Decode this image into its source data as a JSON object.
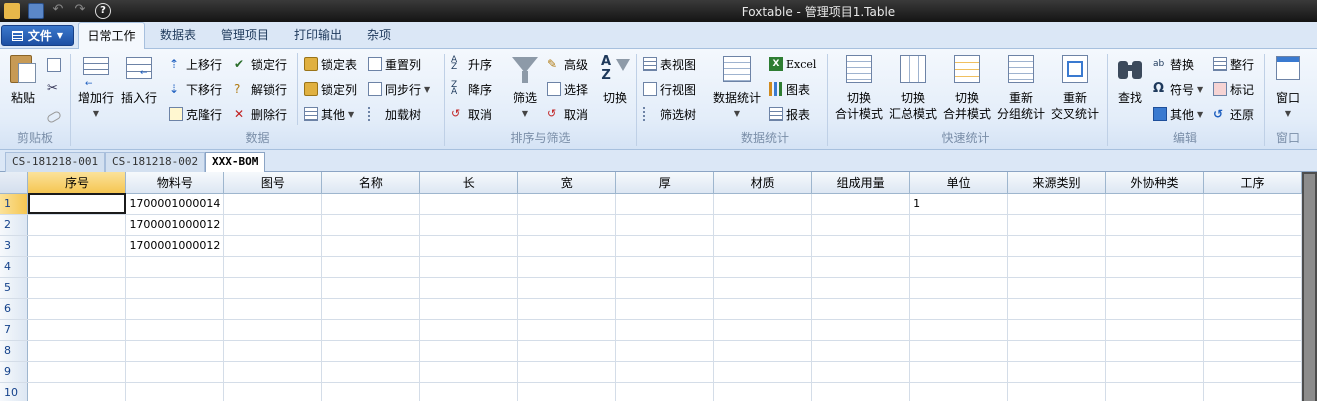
{
  "window": {
    "title": "Foxtable - 管理项目1.Table"
  },
  "ribbon": {
    "file_label": "文件",
    "tabs": [
      "日常工作",
      "数据表",
      "管理项目",
      "打印输出",
      "杂项"
    ],
    "clipboard": {
      "paste": "粘贴",
      "group": "剪贴板"
    },
    "data": {
      "add_row": "增加行",
      "insert_row": "插入行",
      "move_up": "上移行",
      "move_down": "下移行",
      "clone_row": "克隆行",
      "lock_row": "锁定行",
      "unlock_row": "解锁行",
      "delete_row": "删除行",
      "lock_table": "锁定表",
      "lock_col": "锁定列",
      "other": "其他",
      "reset_col": "重置列",
      "sync_row": "同步行",
      "load_tree": "加载树",
      "group": "数据"
    },
    "sort": {
      "asc": "升序",
      "desc": "降序",
      "cancel": "取消",
      "filter": "筛选",
      "advanced": "高级",
      "select": "选择",
      "cancel2": "取消",
      "switch": "切换",
      "group": "排序与筛选"
    },
    "views": {
      "table_view": "表视图",
      "row_view": "行视图",
      "filter_tree": "筛选树"
    },
    "stats": {
      "data_stats": "数据统计",
      "excel": "Excel",
      "chart": "图表",
      "report": "报表",
      "group": "数据统计"
    },
    "quick": {
      "b1a": "切换",
      "b1b": "合计模式",
      "b2a": "切换",
      "b2b": "汇总模式",
      "b3a": "切换",
      "b3b": "合并模式",
      "b4a": "重新",
      "b4b": "分组统计",
      "b5a": "重新",
      "b5b": "交叉统计",
      "group": "快速统计"
    },
    "edit": {
      "find": "查找",
      "replace": "替换",
      "symbol": "符号",
      "other": "其他",
      "format_row": "整行",
      "mark": "标记",
      "restore": "还原",
      "group": "编辑"
    },
    "window_grp": {
      "window": "窗口",
      "group": "窗口"
    }
  },
  "sheet_tabs": [
    "CS-181218-001",
    "CS-181218-002",
    "XXX-BOM"
  ],
  "grid": {
    "columns": [
      "序号",
      "物料号",
      "图号",
      "名称",
      "长",
      "宽",
      "厚",
      "材质",
      "组成用量",
      "单位",
      "来源类别",
      "外协种类",
      "工序"
    ],
    "rows": [
      [
        "1",
        "",
        "1700001000014",
        "",
        "",
        "",
        "",
        "",
        "",
        "",
        "1",
        "",
        "",
        ""
      ],
      [
        "2",
        "",
        "1700001000012",
        "",
        "",
        "",
        "",
        "",
        "",
        "",
        "",
        "",
        "",
        ""
      ],
      [
        "3",
        "",
        "1700001000012",
        "",
        "",
        "",
        "",
        "",
        "",
        "",
        "",
        "",
        "",
        ""
      ],
      [
        "4",
        "",
        "",
        "",
        "",
        "",
        "",
        "",
        "",
        "",
        "",
        "",
        "",
        ""
      ],
      [
        "5",
        "",
        "",
        "",
        "",
        "",
        "",
        "",
        "",
        "",
        "",
        "",
        "",
        ""
      ],
      [
        "6",
        "",
        "",
        "",
        "",
        "",
        "",
        "",
        "",
        "",
        "",
        "",
        "",
        ""
      ],
      [
        "7",
        "",
        "",
        "",
        "",
        "",
        "",
        "",
        "",
        "",
        "",
        "",
        "",
        ""
      ],
      [
        "8",
        "",
        "",
        "",
        "",
        "",
        "",
        "",
        "",
        "",
        "",
        "",
        "",
        ""
      ],
      [
        "9",
        "",
        "",
        "",
        "",
        "",
        "",
        "",
        "",
        "",
        "",
        "",
        "",
        ""
      ],
      [
        "10",
        "",
        "",
        "",
        "",
        "",
        "",
        "",
        "",
        "",
        "",
        "",
        "",
        ""
      ]
    ]
  }
}
